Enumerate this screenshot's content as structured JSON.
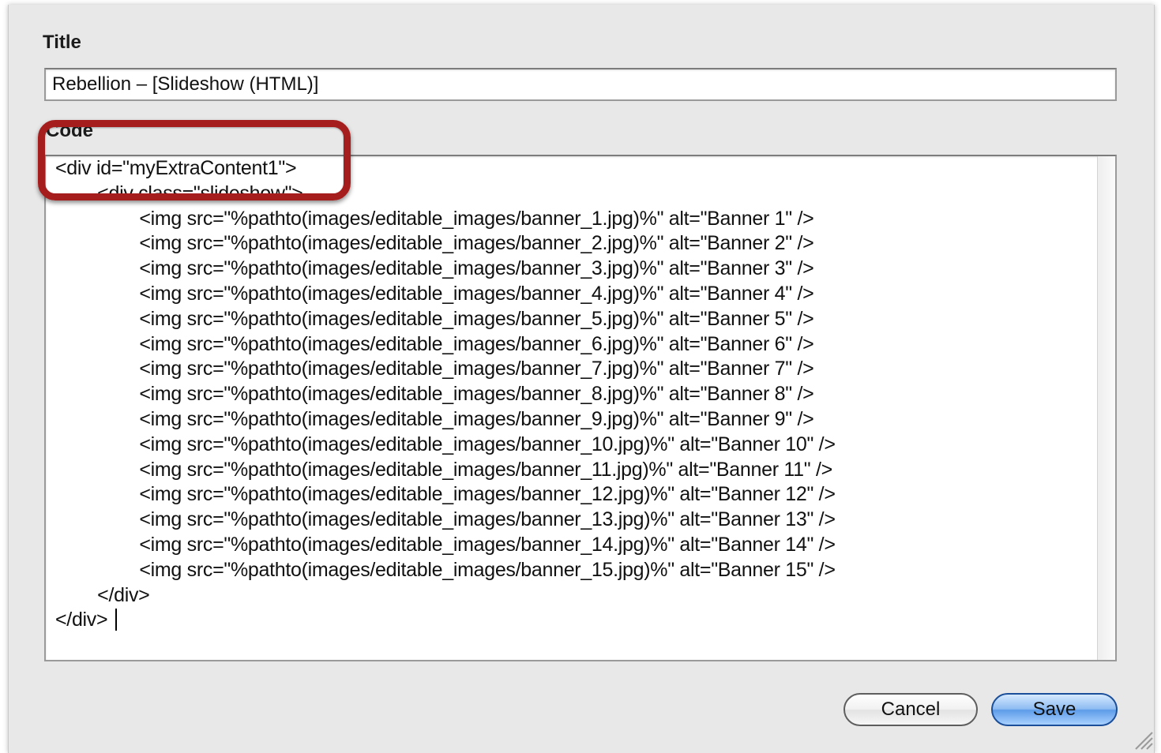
{
  "form": {
    "title_label": "Title",
    "title_value": "Rebellion – [Slideshow (HTML)]",
    "code_label": "Code",
    "code_text": "<div id=\"myExtraContent1\">\n        <div class=\"slideshow\">\n                <img src=\"%pathto(images/editable_images/banner_1.jpg)%\" alt=\"Banner 1\" />\n                <img src=\"%pathto(images/editable_images/banner_2.jpg)%\" alt=\"Banner 2\" />\n                <img src=\"%pathto(images/editable_images/banner_3.jpg)%\" alt=\"Banner 3\" />\n                <img src=\"%pathto(images/editable_images/banner_4.jpg)%\" alt=\"Banner 4\" />\n                <img src=\"%pathto(images/editable_images/banner_5.jpg)%\" alt=\"Banner 5\" />\n                <img src=\"%pathto(images/editable_images/banner_6.jpg)%\" alt=\"Banner 6\" />\n                <img src=\"%pathto(images/editable_images/banner_7.jpg)%\" alt=\"Banner 7\" />\n                <img src=\"%pathto(images/editable_images/banner_8.jpg)%\" alt=\"Banner 8\" />\n                <img src=\"%pathto(images/editable_images/banner_9.jpg)%\" alt=\"Banner 9\" />\n                <img src=\"%pathto(images/editable_images/banner_10.jpg)%\" alt=\"Banner 10\" />\n                <img src=\"%pathto(images/editable_images/banner_11.jpg)%\" alt=\"Banner 11\" />\n                <img src=\"%pathto(images/editable_images/banner_12.jpg)%\" alt=\"Banner 12\" />\n                <img src=\"%pathto(images/editable_images/banner_13.jpg)%\" alt=\"Banner 13\" />\n                <img src=\"%pathto(images/editable_images/banner_14.jpg)%\" alt=\"Banner 14\" />\n                <img src=\"%pathto(images/editable_images/banner_15.jpg)%\" alt=\"Banner 15\" />\n        </div>\n</div>"
  },
  "buttons": {
    "cancel_label": "Cancel",
    "save_label": "Save"
  },
  "colors": {
    "highlight": "#a51d1d",
    "save_accent": "#5d9ce8",
    "sheet_background": "#e8e8e8"
  },
  "icons": {
    "resize": "resize-grip-icon"
  }
}
